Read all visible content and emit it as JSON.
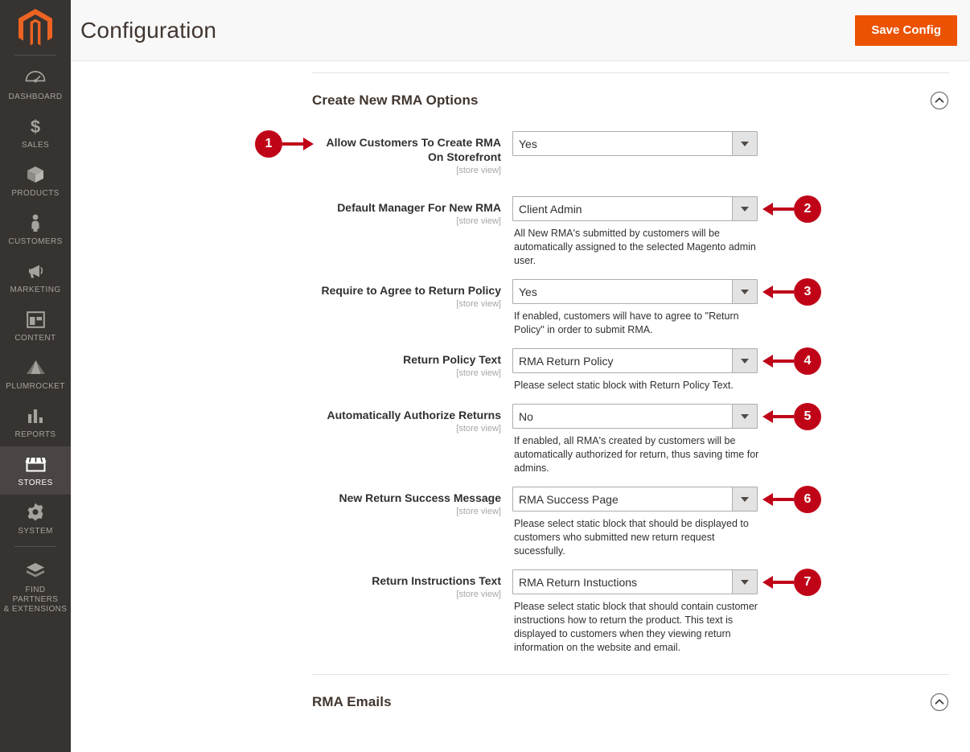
{
  "header": {
    "title": "Configuration",
    "save_label": "Save Config"
  },
  "sidebar": {
    "logo_name": "magento-logo",
    "items": [
      {
        "label": "DASHBOARD",
        "icon": "dashboard-icon",
        "active": false
      },
      {
        "label": "SALES",
        "icon": "sales-dollar-icon",
        "active": false
      },
      {
        "label": "PRODUCTS",
        "icon": "products-box-icon",
        "active": false
      },
      {
        "label": "CUSTOMERS",
        "icon": "customers-person-icon",
        "active": false
      },
      {
        "label": "MARKETING",
        "icon": "marketing-megaphone-icon",
        "active": false
      },
      {
        "label": "CONTENT",
        "icon": "content-layout-icon",
        "active": false
      },
      {
        "label": "PLUMROCKET",
        "icon": "plumrocket-triangle-icon",
        "active": false
      },
      {
        "label": "REPORTS",
        "icon": "reports-bars-icon",
        "active": false
      },
      {
        "label": "STORES",
        "icon": "stores-shop-icon",
        "active": true
      },
      {
        "label": "SYSTEM",
        "icon": "system-gear-icon",
        "active": false
      },
      {
        "label": "FIND PARTNERS\n& EXTENSIONS",
        "icon": "extensions-block-icon",
        "active": false
      }
    ]
  },
  "sections": [
    {
      "title": "Create New RMA Options",
      "collapse_icon": "chevron-up-circle-icon",
      "fields": [
        {
          "label": "Allow Customers To Create RMA On Storefront",
          "scope": "[store view]",
          "value": "Yes",
          "hint": "",
          "callout": "1",
          "callout_side": "left"
        },
        {
          "label": "Default Manager For New RMA",
          "scope": "[store view]",
          "value": "Client Admin",
          "hint": "All New RMA's submitted by customers will be automatically assigned to the selected Magento admin user.",
          "callout": "2",
          "callout_side": "right"
        },
        {
          "label": "Require to Agree to Return Policy",
          "scope": "[store view]",
          "value": "Yes",
          "hint": "If enabled, customers will have to agree to \"Return Policy\" in order to submit RMA.",
          "callout": "3",
          "callout_side": "right"
        },
        {
          "label": "Return Policy Text",
          "scope": "[store view]",
          "value": "RMA Return Policy",
          "hint": "Please select static block with Return Policy Text.",
          "callout": "4",
          "callout_side": "right"
        },
        {
          "label": "Automatically Authorize Returns",
          "scope": "[store view]",
          "value": "No",
          "hint": "If enabled, all RMA's created by customers will be automatically authorized for return, thus saving time for admins.",
          "callout": "5",
          "callout_side": "right"
        },
        {
          "label": "New Return Success Message",
          "scope": "[store view]",
          "value": "RMA Success Page",
          "hint": "Please select static block that should be displayed to customers who submitted new return request sucessfully.",
          "callout": "6",
          "callout_side": "right"
        },
        {
          "label": "Return Instructions Text",
          "scope": "[store view]",
          "value": "RMA Return Instuctions",
          "hint": "Please select static block that should contain customer instructions how to return the product. This text is displayed to customers when they viewing return information on the website and email.",
          "callout": "7",
          "callout_side": "right"
        }
      ]
    },
    {
      "title": "RMA Emails",
      "collapse_icon": "chevron-up-circle-icon",
      "fields": []
    }
  ],
  "colors": {
    "accent": "#eb5202",
    "sidebar_bg": "#373330",
    "callout": "#c00418",
    "header_bg": "#f8f8f8"
  }
}
